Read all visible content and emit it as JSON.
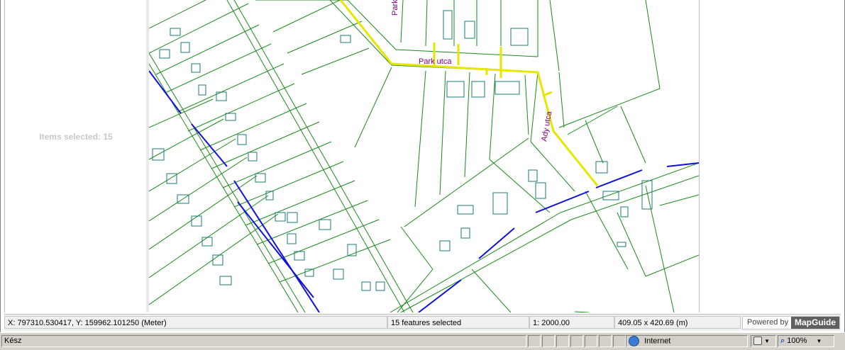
{
  "left_panel": {
    "selection_summary": "Items selected: 15"
  },
  "map": {
    "street_labels": [
      "Park utca",
      "Park",
      "Ady utca"
    ],
    "colors": {
      "parcels": "#1a8a1a",
      "buildings": "#1a7a7a",
      "water": "#1010dd",
      "selection": "#e6e600",
      "labels": "#800080"
    }
  },
  "status": {
    "coordinates": "X: 797310.530417, Y: 159962.101250 (Meter)",
    "features": "15 features selected",
    "scale": "1: 2000.00",
    "extent": "409.05 x 420.69 (m)",
    "powered_by": "Powered by",
    "brand": "MapGuide"
  },
  "browser_status": {
    "text": "Kész",
    "zone": "Internet",
    "zoom": "100%",
    "icons": [
      "internet-globe-icon",
      "protected-mode-icon",
      "zoom-icon",
      "chevron-down-icon"
    ]
  }
}
